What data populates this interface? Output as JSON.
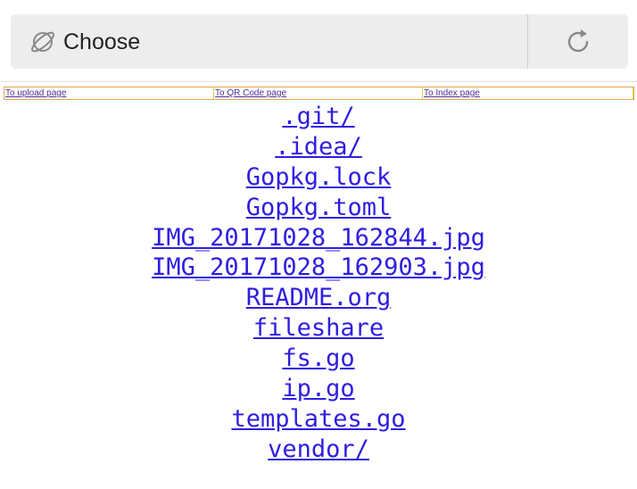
{
  "urlbar": {
    "text": "Choose",
    "globe_icon": "globe-icon",
    "reload_icon": "reload-icon"
  },
  "nav": {
    "links": [
      {
        "label": "To upload page"
      },
      {
        "label": "To QR Code page"
      },
      {
        "label": "To Index page"
      }
    ]
  },
  "files": [
    ".git/",
    ".idea/",
    "Gopkg.lock",
    "Gopkg.toml",
    "IMG_20171028_162844.jpg",
    "IMG_20171028_162903.jpg",
    "README.org",
    "fileshare",
    "fs.go",
    "ip.go",
    "templates.go",
    "vendor/"
  ],
  "colors": {
    "link": "#2e1ee0",
    "nav_link": "#4b2f9b",
    "urlbar_bg": "#ededed"
  }
}
